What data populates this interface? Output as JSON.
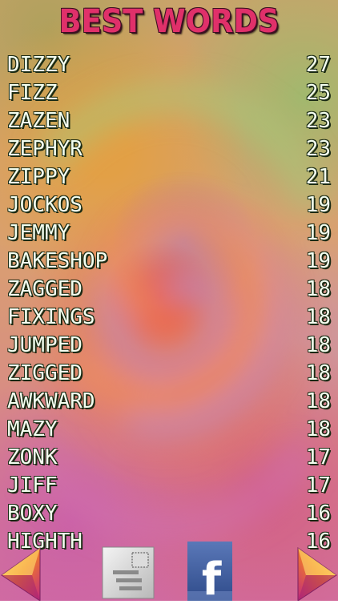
{
  "title": "BEST WORDS",
  "words": [
    {
      "word": "DIZZY",
      "score": "27"
    },
    {
      "word": "FIZZ",
      "score": "25"
    },
    {
      "word": "ZAZEN",
      "score": "23"
    },
    {
      "word": "ZEPHYR",
      "score": "23"
    },
    {
      "word": "ZIPPY",
      "score": "21"
    },
    {
      "word": "JOCKOS",
      "score": "19"
    },
    {
      "word": "JEMMY",
      "score": "19"
    },
    {
      "word": "BAKESHOP",
      "score": "19"
    },
    {
      "word": "ZAGGED",
      "score": "18"
    },
    {
      "word": "FIXINGS",
      "score": "18"
    },
    {
      "word": "JUMPED",
      "score": "18"
    },
    {
      "word": "ZIGGED",
      "score": "18"
    },
    {
      "word": "AWKWARD",
      "score": "18"
    },
    {
      "word": "MAZY",
      "score": "18"
    },
    {
      "word": "ZONK",
      "score": "17"
    },
    {
      "word": "JIFF",
      "score": "17"
    },
    {
      "word": "BOXY",
      "score": "16"
    },
    {
      "word": "HIGHTH",
      "score": "16"
    }
  ],
  "buttons": {
    "facebook_letter": "f",
    "mail_icon": "postcard-icon",
    "prev_icon": "left-arrow-icon",
    "next_icon": "right-arrow-icon"
  },
  "colors": {
    "title": "#e0306a",
    "text": "#f4fff0",
    "facebook": "#3b5998"
  }
}
